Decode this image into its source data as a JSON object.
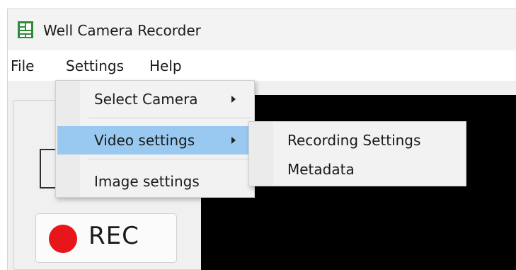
{
  "window": {
    "title": "Well Camera Recorder"
  },
  "menubar": {
    "items": [
      {
        "label": "File"
      },
      {
        "label": "Settings"
      },
      {
        "label": "Help"
      }
    ]
  },
  "settings_menu": {
    "items": [
      {
        "label": "Select Camera",
        "has_submenu": true
      },
      {
        "label": "Video settings",
        "has_submenu": true,
        "highlighted": true
      },
      {
        "label": "Image settings",
        "has_submenu": false
      }
    ]
  },
  "video_submenu": {
    "items": [
      {
        "label": "Recording Settings"
      },
      {
        "label": "Metadata"
      }
    ]
  },
  "controls": {
    "rec_label": "REC"
  },
  "colors": {
    "highlight": "#99c9f0",
    "rec_dot": "#e8161b",
    "video_bg": "#000000",
    "app_icon": "#2f8a3a"
  }
}
